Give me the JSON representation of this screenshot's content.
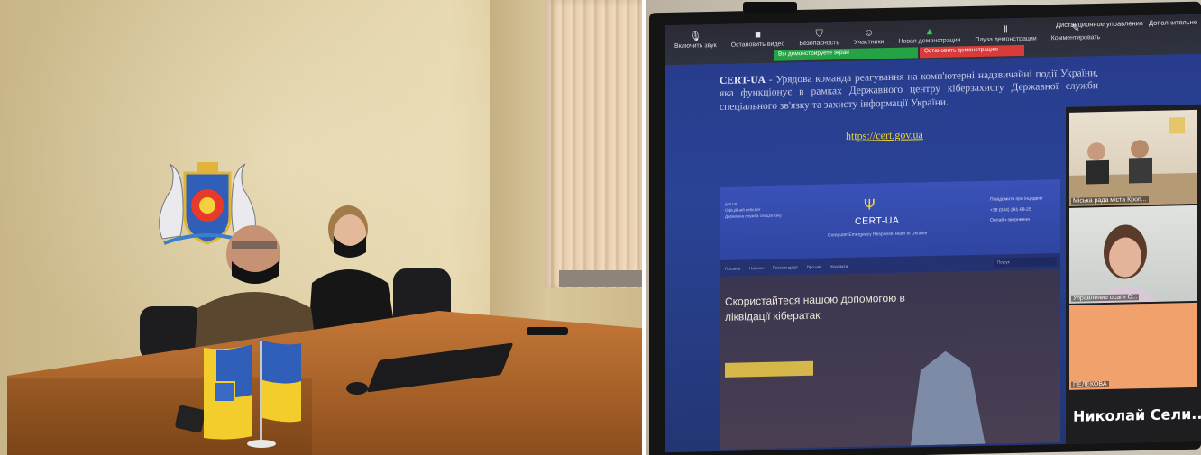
{
  "photos": {
    "left": {
      "scene": "meeting-room",
      "colors": {
        "wall": "#d9c89c",
        "desk": "#b46b2f",
        "flag_blue": "#2f5fb8",
        "flag_yellow": "#f2cd2c"
      }
    },
    "right": {
      "scene": "video-conference-screen",
      "zoom_toolbar": {
        "items": [
          {
            "label": "Включить звук",
            "icon": "microphone-icon"
          },
          {
            "label": "Остановить видео",
            "icon": "camera-icon"
          },
          {
            "label": "Безопасность",
            "icon": "shield-icon"
          },
          {
            "label": "Участники",
            "icon": "participants-icon"
          },
          {
            "label": "Новая демонстрация",
            "icon": "share-screen-icon"
          },
          {
            "label": "Пауза демонстрации",
            "icon": "pause-icon"
          },
          {
            "label": "Комментировать",
            "icon": "pencil-icon"
          }
        ],
        "right_menu": [
          "Дистанционное управление",
          "Дополнительно"
        ],
        "share_notice_green": "Вы демонстрируете экран",
        "share_notice_red": "Остановить демонстрацию"
      },
      "cert_paragraph": {
        "org": "CERT-UA",
        "text": "- Урядова команда реагування на комп'ютерні надзвичайні події України, яка функціонує в рамках Державного центру кіберзахисту Державної служби спеціального зв'язку та захисту інформації України.",
        "link": "https://cert.gov.ua"
      },
      "website": {
        "logo_text": "CERT-UA",
        "subtitle": "Computer Emergency Response Team of Ukraine",
        "left_meta": [
          "gov.ua",
          "Офіційний вебсайт",
          "Державна служба спецзв'язку"
        ],
        "right_meta": [
          "Повідомити про інцидент",
          "+38 (044) 281-88-25",
          "Онлайн-звернення"
        ],
        "nav": [
          "Головна",
          "Новини",
          "Рекомендації",
          "Про нас",
          "Контакти"
        ],
        "search_placeholder": "Пошук",
        "hero_text": "Скористайтеся нашою допомогою в ліквідації кібератак"
      },
      "participants": [
        {
          "label": "Міська рада міста Кроп..."
        },
        {
          "label": "Управление осаги С..."
        },
        {
          "label": "ПЕЛЕКОВА"
        }
      ],
      "active_speaker": "Николай Сели..."
    }
  }
}
